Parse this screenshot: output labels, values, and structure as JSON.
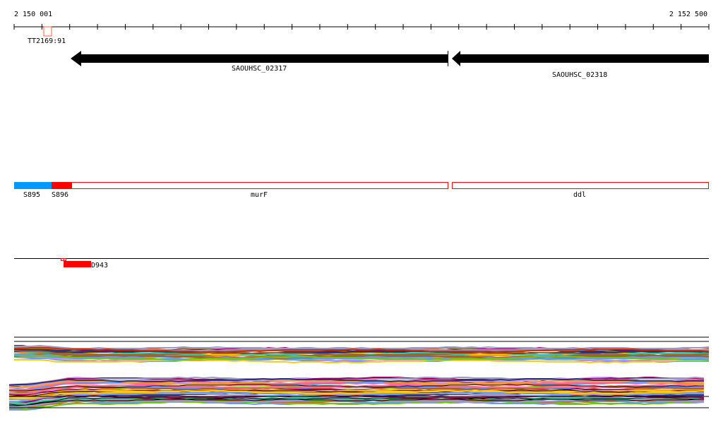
{
  "ruler": {
    "start_label": "2 150 001",
    "end_label": "2 152 500",
    "start": 2150001,
    "end": 2152500,
    "tick_interval": 100
  },
  "marker": {
    "label": "TT2169:91",
    "color": "#ff6040"
  },
  "genes": [
    {
      "name": "SAOUHSC_02317",
      "start": 2150201,
      "end": 2151561,
      "strand": "-"
    },
    {
      "name": "SAOUHSC_02318",
      "start": 2151571,
      "end": 2152500,
      "strand": "-"
    }
  ],
  "segments": [
    {
      "label": "S895",
      "start": 2150001,
      "end": 2150137,
      "color": "#0099ff",
      "filled": true
    },
    {
      "label": "S896",
      "start": 2150137,
      "end": 2150207,
      "color": "#ff0000",
      "filled": true
    },
    {
      "label": "murF",
      "start": 2150207,
      "end": 2151561,
      "color": "#ff0000",
      "filled": false
    },
    {
      "label": "ddl",
      "start": 2151571,
      "end": 2152500,
      "color": "#ff0000",
      "filled": false
    }
  ],
  "feature": {
    "label": "D943",
    "color": "#ff0000"
  },
  "track_palette": [
    "#000000",
    "#8b7d2b",
    "#cc6633",
    "#990066",
    "#66cc00",
    "#6699ff",
    "#cc3300",
    "#996633",
    "#ff6699",
    "#9999cc",
    "#ff9933",
    "#333366",
    "#33cc99",
    "#ffcc00",
    "#cc99ff"
  ]
}
